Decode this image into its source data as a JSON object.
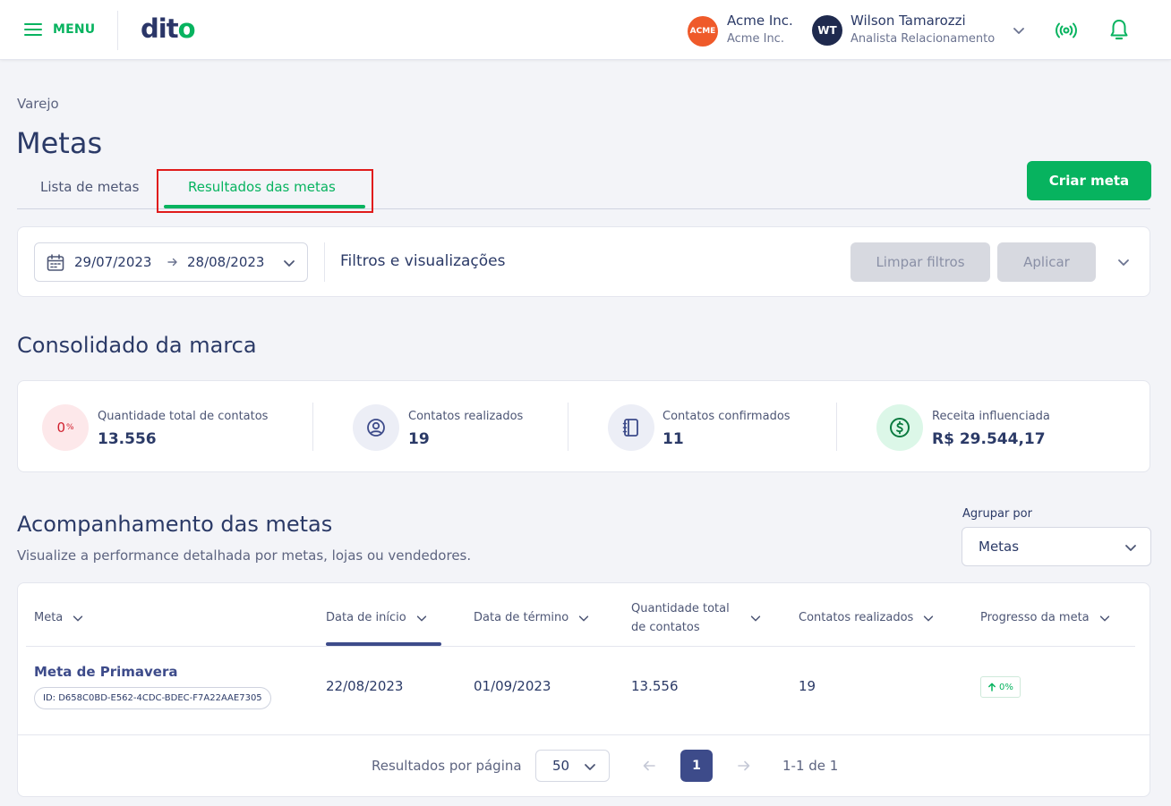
{
  "header": {
    "menu_label": "MENU",
    "logo_text": "dit",
    "logo_dot": "o",
    "brand": {
      "badge": "ACME",
      "name": "Acme Inc.",
      "sub": "Acme Inc."
    },
    "user": {
      "initials": "WT",
      "name": "Wilson Tamarozzi",
      "role": "Analista Relacionamento"
    },
    "icons": [
      "menu-icon",
      "chevron-down-icon",
      "signal-icon",
      "bell-icon"
    ],
    "accent_color": "#07b35f"
  },
  "page": {
    "breadcrumb": "Varejo",
    "title": "Metas",
    "tabs": [
      {
        "label": "Lista de metas",
        "active": false
      },
      {
        "label": "Resultados das metas",
        "active": true
      }
    ],
    "create_button": "Criar meta"
  },
  "filters": {
    "date_start": "29/07/2023",
    "date_end": "28/08/2023",
    "label": "Filtros e visualizações",
    "clear_button": "Limpar filtros",
    "apply_button": "Aplicar"
  },
  "consolidated": {
    "title": "Consolidado da marca",
    "kpis": [
      {
        "icon": "percent-badge",
        "icon_text": "0",
        "icon_unit": "%",
        "label": "Quantidade total de contatos",
        "value": "13.556"
      },
      {
        "icon": "user-circle-icon",
        "label": "Contatos realizados",
        "value": "19"
      },
      {
        "icon": "notebook-icon",
        "label": "Contatos confirmados",
        "value": "11"
      },
      {
        "icon": "dollar-icon",
        "label": "Receita influenciada",
        "value": "R$ 29.544,17"
      }
    ]
  },
  "tracking": {
    "title": "Acompanhamento das metas",
    "subtitle": "Visualize a performance detalhada por metas, lojas ou vendedores.",
    "group_by_label": "Agrupar por",
    "group_by_value": "Metas",
    "columns": [
      "Meta",
      "Data de início",
      "Data de término",
      "Quantidade total de contatos",
      "Contatos realizados",
      "Progresso da meta"
    ],
    "rows": [
      {
        "name": "Meta de Primavera",
        "id": "ID: D658C0BD-E562-4CDC-BDEC-F7A22AAE7305",
        "start": "22/08/2023",
        "end": "01/09/2023",
        "total_contacts": "13.556",
        "contacts_done": "19",
        "progress": "0%"
      }
    ],
    "pagination": {
      "per_page_label": "Resultados por página",
      "per_page_value": "50",
      "current_page": "1",
      "range": "1-1 de 1"
    }
  }
}
